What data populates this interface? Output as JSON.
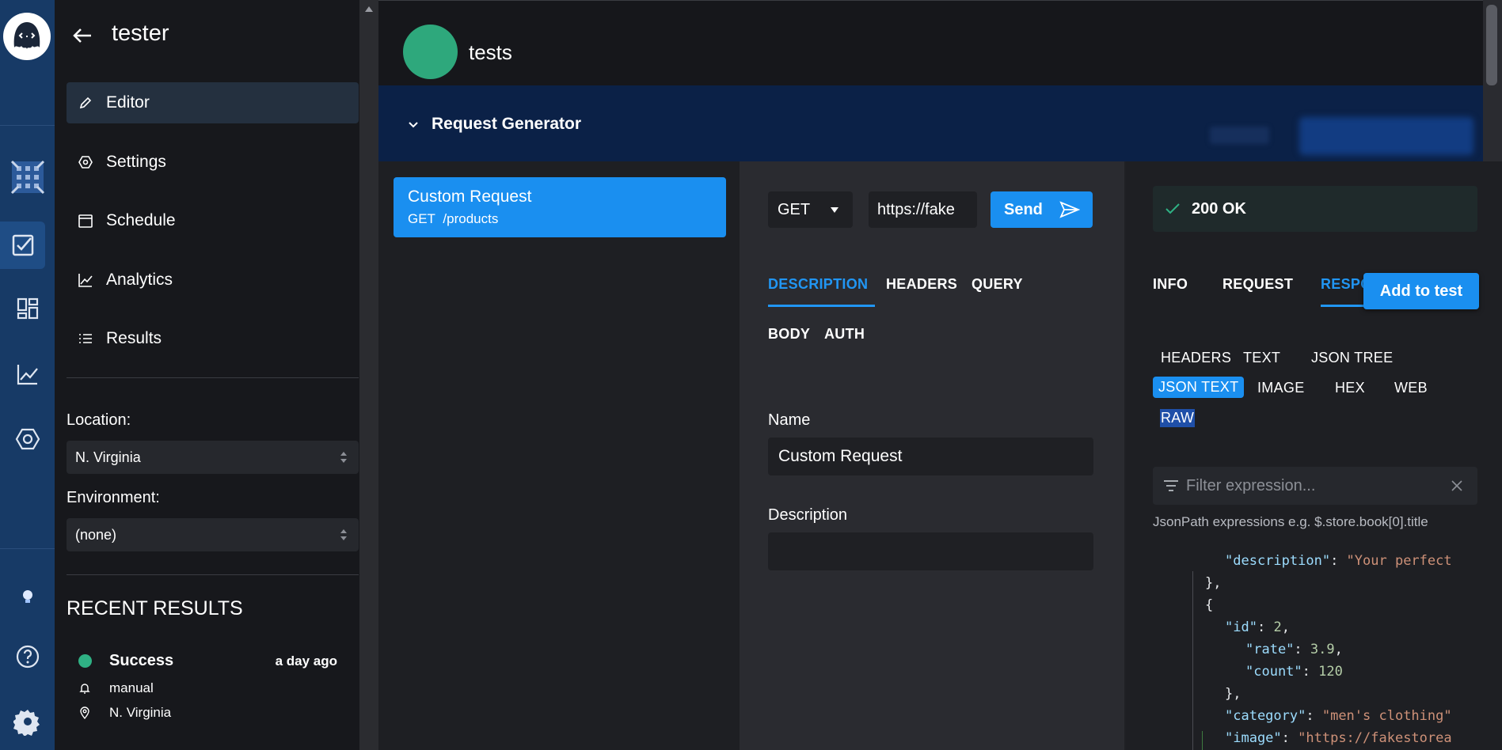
{
  "colors": {
    "rail_bg": "#173a66",
    "accent": "#1a8ff0",
    "success": "#2fb184",
    "tab_active": "#2196f3"
  },
  "rail": {
    "icons": [
      "octopus-logo-icon",
      "grid-pattern-icon",
      "checklist-icon",
      "dashboard-icon",
      "chart-icon",
      "hexagon-icon",
      "lightbulb-icon",
      "help-icon",
      "gear-icon"
    ]
  },
  "nav": {
    "title": "tester",
    "items": [
      {
        "label": "Editor",
        "icon": "pencil-icon"
      },
      {
        "label": "Settings",
        "icon": "settings-icon"
      },
      {
        "label": "Schedule",
        "icon": "calendar-icon"
      },
      {
        "label": "Analytics",
        "icon": "trend-icon"
      },
      {
        "label": "Results",
        "icon": "list-icon"
      }
    ],
    "location_label": "Location:",
    "location_value": "N. Virginia",
    "environment_label": "Environment:",
    "environment_value": "(none)",
    "recent_title": "RECENT RESULTS",
    "recent": {
      "status": "Success",
      "time": "a day ago",
      "trigger": "manual",
      "location": "N. Virginia"
    }
  },
  "header": {
    "title": "tests",
    "generator_title": "Request Generator"
  },
  "requests": [
    {
      "name": "Custom Request",
      "method": "GET",
      "path": "/products"
    }
  ],
  "editor": {
    "method": "GET",
    "url": "https://fake",
    "send_label": "Send",
    "tabs": [
      "DESCRIPTION",
      "HEADERS",
      "QUERY",
      "BODY",
      "AUTH"
    ],
    "name_label": "Name",
    "name_value": "Custom Request",
    "description_label": "Description",
    "description_value": ""
  },
  "response": {
    "status": "200 OK",
    "tabs": [
      "INFO",
      "REQUEST",
      "RESPO"
    ],
    "add_to_test": "Add to test",
    "subtabs": [
      "HEADERS",
      "TEXT",
      "JSON TREE",
      "JSON TEXT",
      "IMAGE",
      "HEX",
      "WEB",
      "RAW"
    ],
    "filter_placeholder": "Filter expression...",
    "filter_hint": "JsonPath expressions e.g. $.store.book[0].title",
    "json_lines": [
      {
        "key": "\"description\"",
        "sep": ": ",
        "value": "\"Your perfect",
        "vtype": "s"
      },
      {
        "text": "},"
      },
      {
        "text": "{"
      },
      {
        "key": "\"id\"",
        "sep": ": ",
        "value": "2",
        "tail": ",",
        "vtype": "n"
      },
      {
        "key": "\"rate\"",
        "sep": ": ",
        "value": "3.9",
        "tail": ",",
        "vtype": "n"
      },
      {
        "key": "\"count\"",
        "sep": ": ",
        "value": "120",
        "vtype": "n"
      },
      {
        "text": "},"
      },
      {
        "key": "\"category\"",
        "sep": ": ",
        "value": "\"men's clothing\"",
        "vtype": "s"
      },
      {
        "key": "\"image\"",
        "sep": ": ",
        "value": "\"https://fakestorea",
        "vtype": "s"
      }
    ]
  }
}
